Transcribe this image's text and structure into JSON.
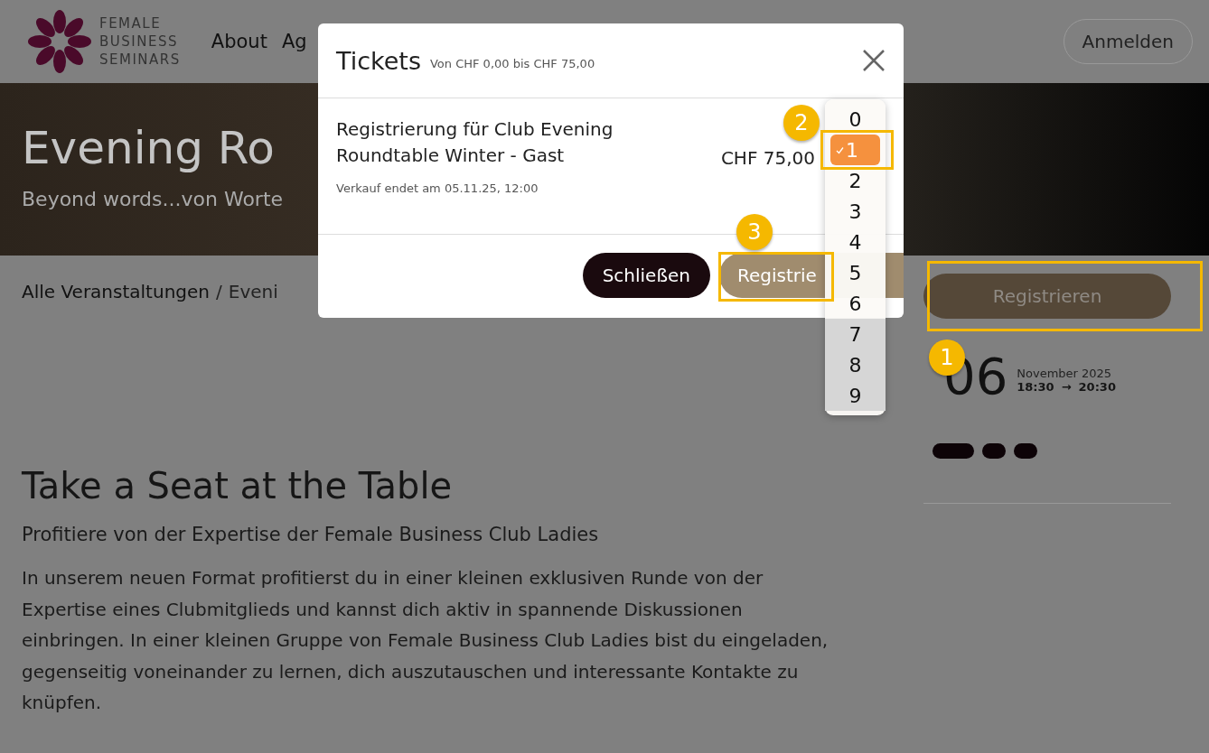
{
  "header": {
    "logo_lines": [
      "FEMALE",
      "BUSINESS",
      "SEMINARS"
    ],
    "nav": [
      "About",
      "Ag"
    ],
    "login_button": "Anmelden"
  },
  "hero": {
    "title": "Evening Ro",
    "subtitle": "Beyond words...von Worte"
  },
  "breadcrumb": [
    {
      "label": "Alle Veranstaltungen",
      "kind": "link"
    },
    {
      "label": "/",
      "kind": "separator"
    },
    {
      "label": "Eveni",
      "kind": "current"
    }
  ],
  "content": {
    "heading": "Take a Seat at the Table",
    "subheading": "Profitiere von der Expertise der Female Business Club Ladies",
    "paragraph": "In unserem neuen Format profitierst du in einer kleinen exklusiven Runde von der Expertise eines Clubmitglieds und kannst dich aktiv in spannende Diskussionen einbringen. In einer kleinen Gruppe von Female Business Club Ladies bist du eingeladen, gegenseitig voneinander zu lernen, dich auszutauschen und interessante Kontakte zu knüpfen."
  },
  "sidebar": {
    "register_button": "Registrieren",
    "day": "06",
    "month_year": "November 2025",
    "start": "18:30",
    "arrow": "→",
    "end": "20:30",
    "pills": [
      {
        "kind": "wide"
      },
      {
        "kind": "round"
      },
      {
        "kind": "round"
      }
    ]
  },
  "modal": {
    "title": "Tickets",
    "price_range": "Von CHF 0,00 bis CHF 75,00",
    "ticket_name": "Registrierung für Club Evening Roundtable Winter - Gast",
    "price": "CHF 75,00",
    "sale_end": "Verkauf endet am 05.11.25, 12:00",
    "close_button": "Schließen",
    "register_button": "Registrie"
  },
  "quantity_options": [
    {
      "label": "0",
      "selected": false
    },
    {
      "label": "1",
      "selected": true
    },
    {
      "label": "2",
      "selected": false
    },
    {
      "label": "3",
      "selected": false
    },
    {
      "label": "4",
      "selected": false
    },
    {
      "label": "5",
      "selected": false
    },
    {
      "label": "6",
      "selected": false
    },
    {
      "label": "7",
      "selected": false
    },
    {
      "label": "8",
      "selected": false
    },
    {
      "label": "9",
      "selected": false
    }
  ],
  "annotations": [
    {
      "number": "1"
    },
    {
      "number": "2"
    },
    {
      "number": "3"
    }
  ]
}
